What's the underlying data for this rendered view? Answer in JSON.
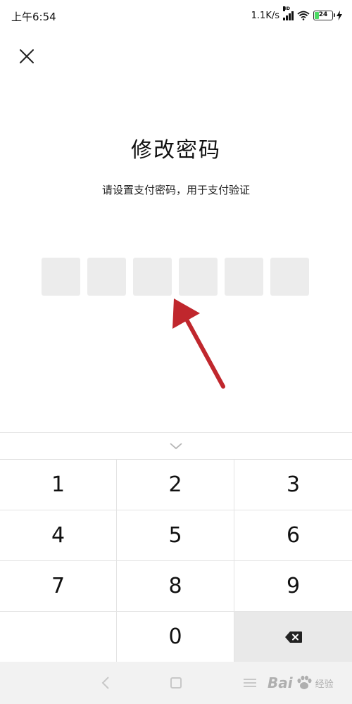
{
  "status_bar": {
    "time": "上午6:54",
    "net_speed": "1.1K/s",
    "battery_level": "24",
    "icons": [
      "hd-signal-icon",
      "wifi-icon",
      "battery-icon",
      "charging-icon"
    ]
  },
  "header": {
    "close_icon": "close-icon"
  },
  "main": {
    "title": "修改密码",
    "subtitle": "请设置支付密码，用于支付验证",
    "pin_length": 6,
    "pin_filled": 0
  },
  "annotation": {
    "arrow_color": "#c0272d"
  },
  "keyboard": {
    "collapse_icon": "chevron-down-icon",
    "keys": [
      "1",
      "2",
      "3",
      "4",
      "5",
      "6",
      "7",
      "8",
      "9",
      "0"
    ],
    "delete_icon": "backspace-icon"
  },
  "nav_bar": {
    "icons": [
      "back-icon",
      "home-icon",
      "menu-icon"
    ]
  },
  "watermark": {
    "brand": "Bai",
    "suffix": "经验"
  }
}
